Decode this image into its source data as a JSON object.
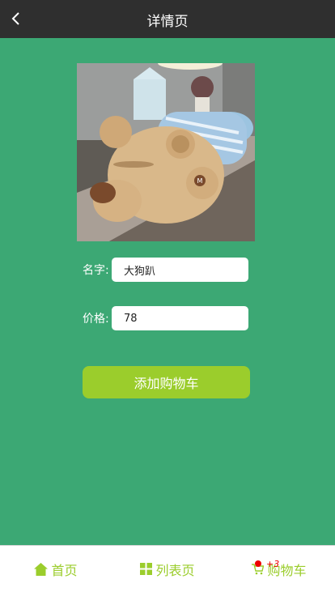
{
  "header": {
    "title": "详情页"
  },
  "product": {
    "name_label": "名字:",
    "name_value": "大狗趴",
    "price_label": "价格:",
    "price_value": "78"
  },
  "actions": {
    "add_to_cart_label": "添加购物车"
  },
  "tabbar": {
    "items": [
      {
        "label": "首页",
        "icon": "home-icon"
      },
      {
        "label": "列表页",
        "icon": "grid-icon"
      },
      {
        "label": "购物车",
        "icon": "cart-icon"
      }
    ],
    "cart_badge": "+3"
  },
  "colors": {
    "background": "#3ca874",
    "header": "#2f2f2f",
    "accent": "#9bcd2c",
    "badge": "#e00000"
  }
}
